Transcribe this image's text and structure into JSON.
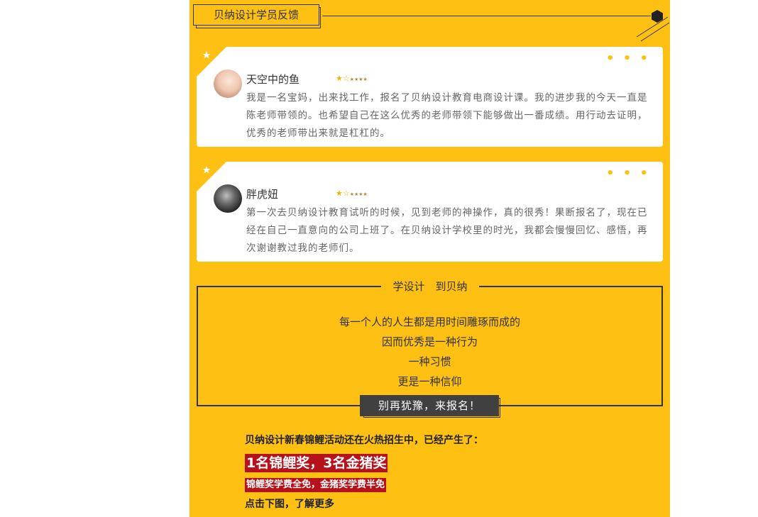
{
  "section": {
    "title": "贝纳设计学员反馈"
  },
  "colors": {
    "accent": "#fdc013",
    "dark": "#333333",
    "promo_red": "#b5121b"
  },
  "reviews": [
    {
      "name": "天空中的鱼",
      "stars": "★☆",
      "stars_small": "★★★★",
      "text": "我是一名宝妈，出来找工作，报名了贝纳设计教育电商设计课。我的进步我的今天一直是陈老师带领的。也希望自己在这么优秀的老师带领下能够做出一番成绩。用行动去证明，优秀的老师带出来就是杠杠的。",
      "menu": "• • •"
    },
    {
      "name": "胖虎妞",
      "stars": "★☆",
      "stars_small": "★★★★",
      "text": "第一次去贝纳设计教育试听的时候，见到老师的神操作，真的很秀！果断报名了，现在已经在自己一直意向的公司上班了。在贝纳设计学校里的时光，我都会慢慢回忆、感悟，再次谢谢教过我的老师们。",
      "menu": "• • •"
    }
  ],
  "motto": {
    "title": "学设计　到贝纳",
    "lines": [
      "每一个人的人生都是用时间雕琢而成的",
      "因而优秀是一种行为",
      "一种习惯",
      "更是一种信仰"
    ],
    "cta": "别再犹豫，来报名！"
  },
  "promo": {
    "line1": "贝纳设计新春锦鲤活动还在火热招生中，已经产生了：",
    "line2": "1名锦鲤奖，3名金猪奖",
    "line3": "锦鲤奖学费全免，金猪奖学费半免",
    "line4": "点击下图，了解更多"
  }
}
